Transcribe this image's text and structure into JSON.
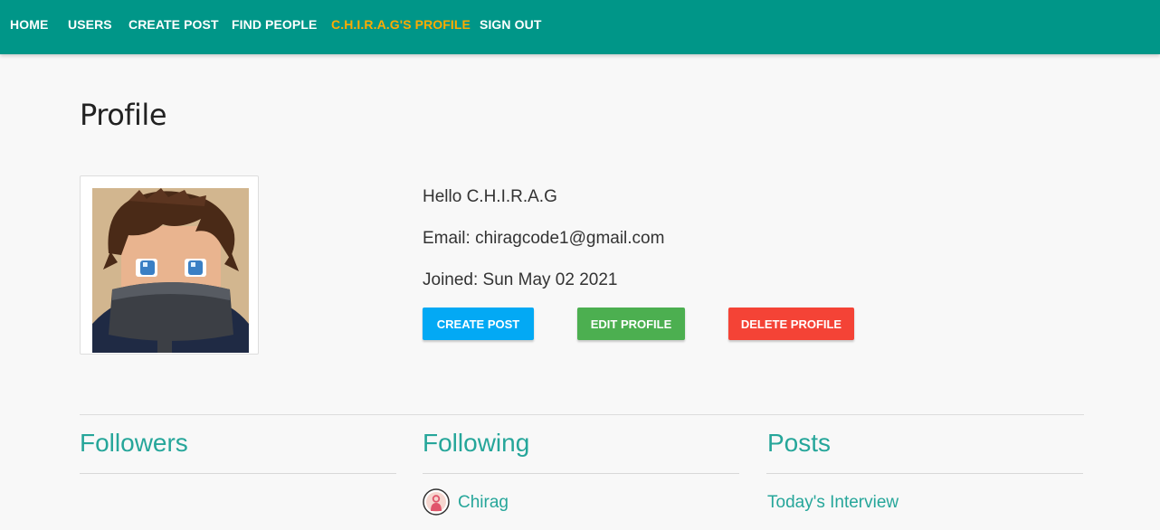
{
  "nav": {
    "home": "HOME",
    "users": "USERS",
    "create_post": "CREATE POST",
    "find_people": "FIND PEOPLE",
    "profile": "C.H.I.R.A.G'S PROFILE",
    "sign_out": "SIGN OUT"
  },
  "page_title": "Profile",
  "profile": {
    "hello": "Hello C.H.I.R.A.G",
    "email": "Email: chiragcode1@gmail.com",
    "joined": "Joined: Sun May 02 2021"
  },
  "buttons": {
    "create_post": "CREATE POST",
    "edit_profile": "EDIT PROFILE",
    "delete_profile": "DELETE PROFILE"
  },
  "columns": {
    "followers": {
      "title": "Followers",
      "items": []
    },
    "following": {
      "title": "Following",
      "items": [
        {
          "name": "Chirag"
        }
      ]
    },
    "posts": {
      "title": "Posts",
      "items": [
        {
          "title": "Today's Interview"
        }
      ]
    }
  },
  "colors": {
    "navbar": "#009688",
    "nav_active": "#ffab00",
    "accent_teal": "#26a69a",
    "btn_blue": "#03a9f4",
    "btn_green": "#4caf50",
    "btn_red": "#f44336"
  }
}
